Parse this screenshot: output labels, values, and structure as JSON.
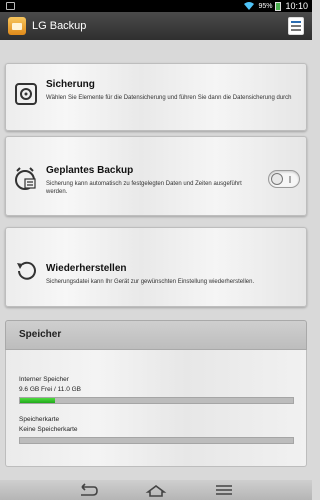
{
  "status_bar": {
    "battery_percent": "95%",
    "time": "10:10"
  },
  "app_bar": {
    "title": "LG Backup"
  },
  "cards": [
    {
      "title": "Sicherung",
      "subtitle": "Wählen Sie Elemente für die Datensicherung und führen Sie dann die Datensicherung durch",
      "icon": "backup-disk-icon"
    },
    {
      "title": "Geplantes Backup",
      "subtitle": "Sicherung kann automatisch zu festgelegten Daten und Zeiten ausgeführt werden.",
      "icon": "alarm-clock-icon",
      "toggle_on": false
    },
    {
      "title": "Wiederherstellen",
      "subtitle": "Sicherungsdatei kann Ihr Gerät zur gewünschten Einstellung wiederherstellen.",
      "icon": "restore-icon"
    }
  ],
  "storage": {
    "title": "Speicher",
    "internal_label": "Interner Speicher",
    "internal_value": "9.6 GB Frei  / 11.0 GB",
    "internal_used_fraction": 0.13,
    "card_label": "Speicherkarte",
    "card_value": "Keine Speicherkarte",
    "card_used_fraction": 0
  },
  "colors": {
    "progress_fill": "#20a91b",
    "app_bar": "#3a3a3a"
  },
  "nav_icons": [
    "back-icon",
    "home-icon",
    "menu-icon"
  ]
}
